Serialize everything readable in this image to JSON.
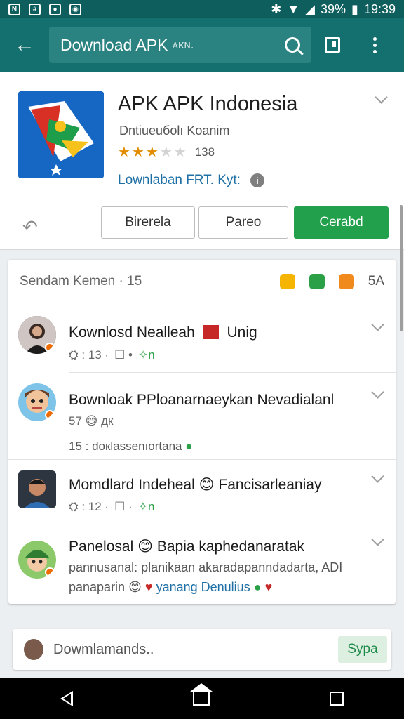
{
  "status_bar": {
    "battery": "39%",
    "time": "19:39"
  },
  "app_bar": {
    "search_query": "Download APK",
    "search_suffix": "ᴀᴋɴ."
  },
  "app": {
    "name": "APK APK Indonesia",
    "developer": "Dntiueuбоlı Koanim",
    "rating_stars": 3,
    "rating_max": 5,
    "rating_count": "138",
    "download_link": "Lownlaban FRT. Kyt:",
    "buttons": {
      "first": "Birerela",
      "second": "Pareo",
      "install": "Cerabd"
    }
  },
  "reviews": {
    "header": "Sendam Kemen · 15",
    "header_count": "5А",
    "items": [
      {
        "title": "Kownlosd Nealleah",
        "title_tail": "Unig",
        "meta": [
          "⛭ : 13 ·",
          "☐ •",
          "✧n"
        ]
      },
      {
        "title": "Bownloak PPloanarnaeykan Nevadialanl",
        "meta": [
          "57 😅 дк"
        ],
        "sub": "15 : doкlassenıortana"
      },
      {
        "title": "Momdlard Indeheal",
        "title_tail": "Fancisarleaniay",
        "meta": [
          "⛭ : 12 ·",
          "☐ ·",
          "✧n"
        ]
      },
      {
        "title": "Panelosal",
        "title_tail": "Bapia kaphedanaratak",
        "line2": "pannusanal: planikaan akaradapanndadarta, ADI",
        "line3_a": "panaparin",
        "line3_b": "yanang Denulius"
      }
    ]
  },
  "compose": {
    "placeholder": "Dowmlamands..",
    "send_label": "Sypa"
  }
}
